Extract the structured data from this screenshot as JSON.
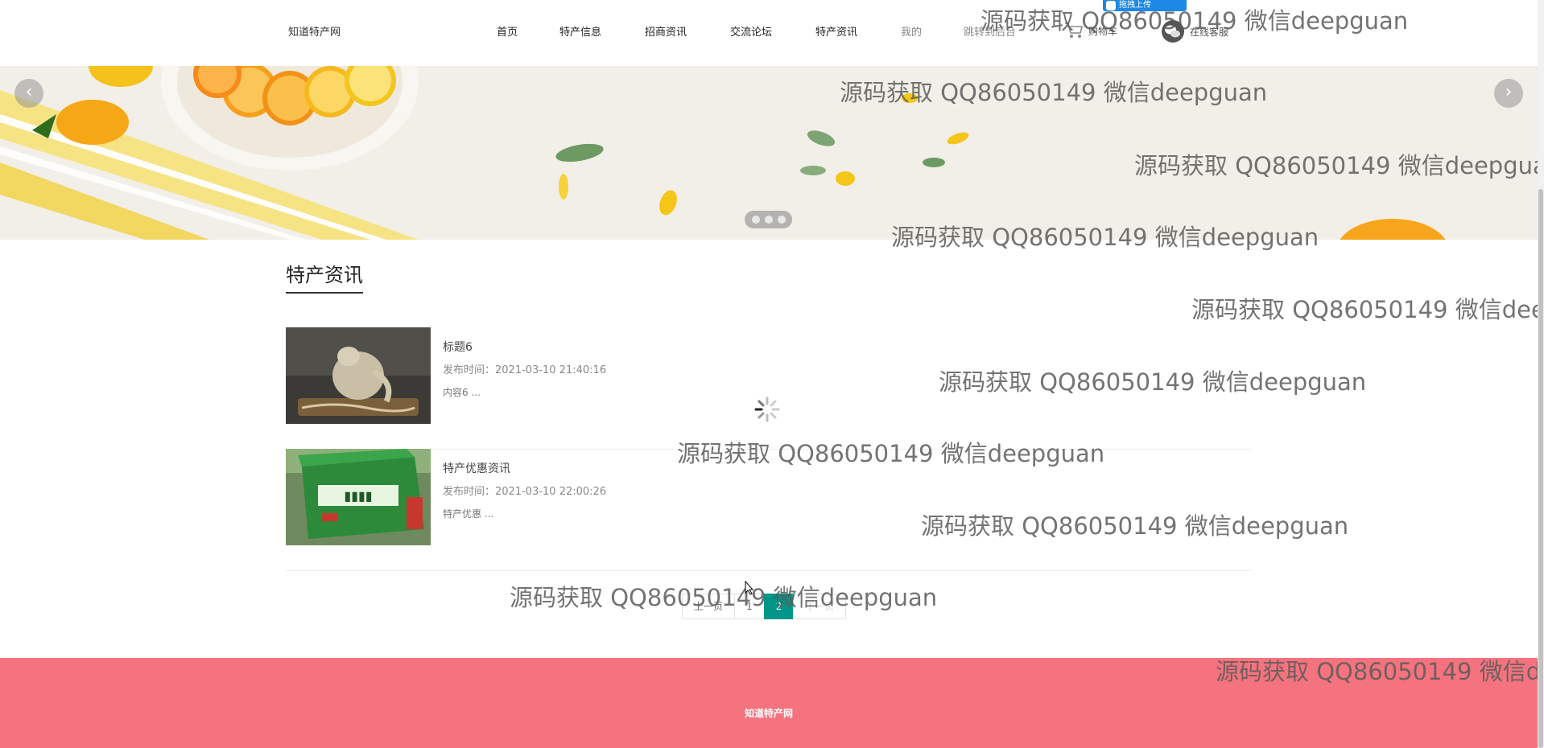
{
  "header": {
    "site_title": "知道特产网",
    "nav": [
      "首页",
      "特产信息",
      "招商资讯",
      "交流论坛",
      "特产资讯",
      "我的",
      "跳转到后台"
    ],
    "cart_label": "购物车",
    "service_label": "在线客服",
    "upload_label": "拖拽上传"
  },
  "banner": {
    "prev_icon": "chevron-left-icon",
    "next_icon": "chevron-right-icon",
    "slide_count": 3
  },
  "section": {
    "title": "特产资讯"
  },
  "news": [
    {
      "title": "标题6",
      "date_label": "发布时间：",
      "date": "2021-03-10 21:40:16",
      "content": "内容6 ..."
    },
    {
      "title": "特产优惠资讯",
      "date_label": "发布时间：",
      "date": "2021-03-10 22:00:26",
      "content": "特产优惠 ..."
    }
  ],
  "pagination": {
    "prev": "上一页",
    "pages": [
      "1",
      "2"
    ],
    "current": "2",
    "next": "下一页"
  },
  "footer": {
    "text": "知道特产网"
  },
  "watermark": "源码获取 QQ86050149 微信deepguan",
  "colors": {
    "footer_bg": "#f4737e",
    "pager_active": "#009688"
  }
}
